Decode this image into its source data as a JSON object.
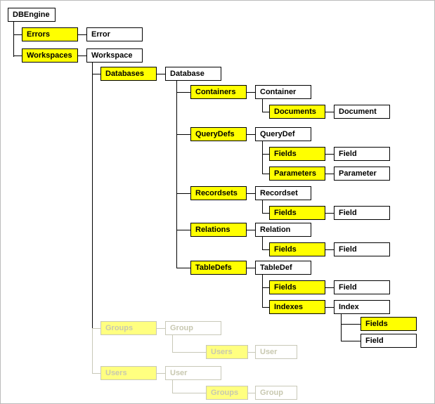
{
  "root": "DBEngine",
  "errors_c": "Errors",
  "error": "Error",
  "workspaces_c": "Workspaces",
  "workspace": "Workspace",
  "databases_c": "Databases",
  "database": "Database",
  "containers_c": "Containers",
  "container": "Container",
  "documents_c": "Documents",
  "document": "Document",
  "querydefs_c": "QueryDefs",
  "querydef": "QueryDef",
  "fields_c": "Fields",
  "field": "Field",
  "parameters_c": "Parameters",
  "parameter": "Parameter",
  "recordsets_c": "Recordsets",
  "recordset": "Recordset",
  "relations_c": "Relations",
  "relation": "Relation",
  "tabledefs_c": "TableDefs",
  "tabledef": "TableDef",
  "indexes_c": "Indexes",
  "index": "Index",
  "groups_c": "Groups",
  "group": "Group",
  "users_c": "Users",
  "user": "User"
}
